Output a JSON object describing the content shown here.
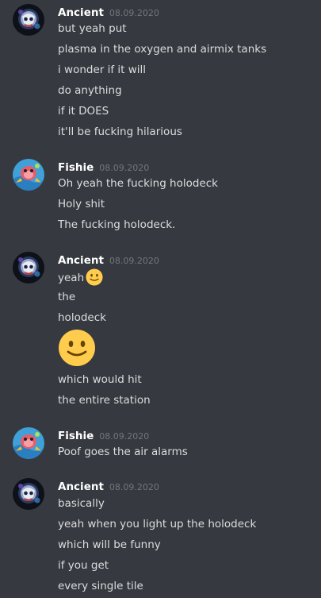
{
  "colors": {
    "background": "#36393f",
    "author": "#ffffff",
    "timestamp": "#72767d",
    "message": "#dcddde",
    "emoji_fill": "#ffcc4d"
  },
  "messages": [
    {
      "author": "Ancient",
      "timestamp": "08.09.2020",
      "avatar_icon": "ancient-avatar-icon",
      "lines": [
        "but yeah put",
        "plasma in the oxygen and airmix tanks",
        "i wonder if it will",
        "do anything",
        "if it DOES",
        "it'll be fucking hilarious"
      ]
    },
    {
      "author": "Fishie",
      "timestamp": "08.09.2020",
      "avatar_icon": "fishie-avatar-icon",
      "lines": [
        "Oh yeah the fucking holodeck",
        "Holy shit",
        "The fucking holodeck."
      ]
    },
    {
      "author": "Ancient",
      "timestamp": "08.09.2020",
      "avatar_icon": "ancient-avatar-icon",
      "lines": [
        "yeah",
        "the",
        "holodeck",
        "which would hit",
        "the entire station"
      ],
      "emoji": "slightly-smiling-face-emoji"
    },
    {
      "author": "Fishie",
      "timestamp": "08.09.2020",
      "avatar_icon": "fishie-avatar-icon",
      "lines": [
        "Poof goes the air alarms"
      ]
    },
    {
      "author": "Ancient",
      "timestamp": "08.09.2020",
      "avatar_icon": "ancient-avatar-icon",
      "lines": [
        "basically",
        "yeah when you light up the holodeck",
        "which will be funny",
        "if you get",
        "every single tile"
      ]
    }
  ]
}
